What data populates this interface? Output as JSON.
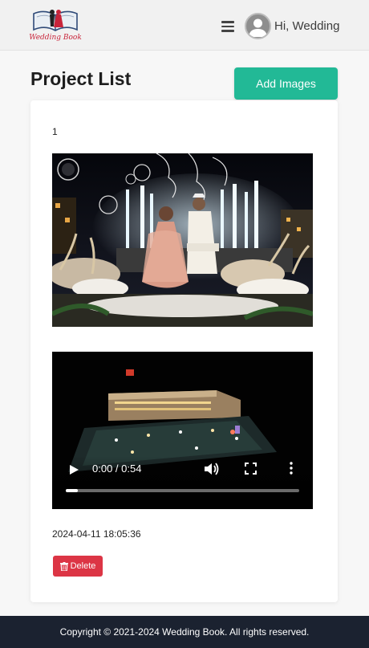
{
  "brand": {
    "logo_text": "Wedding Book"
  },
  "header": {
    "greeting": "Hi, Wedding"
  },
  "main": {
    "title": "Project List",
    "add_images_label": "Add Images"
  },
  "project": {
    "number": "1",
    "video": {
      "time": "0:00 / 0:54",
      "progress": 0.05
    },
    "timestamp": "2024-04-11 18:05:36",
    "delete_label": "Delete"
  },
  "footer": {
    "copyright": "Copyright © 2021-2024 Wedding Book. All rights reserved."
  },
  "colors": {
    "accent": "#22b996",
    "danger": "#dc3545",
    "footer_bg": "#1b2230"
  }
}
